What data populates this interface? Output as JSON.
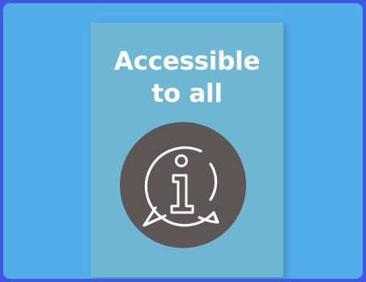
{
  "poster": {
    "line1": "Accessible",
    "line2": "to all"
  },
  "colors": {
    "page_border": "#3f59e4",
    "background": "#52aeea",
    "poster": "#6fb6d3",
    "circle": "#5d5655",
    "text": "#ffffff"
  },
  "icons": {
    "badge": "info-speech-bubble-icon"
  }
}
